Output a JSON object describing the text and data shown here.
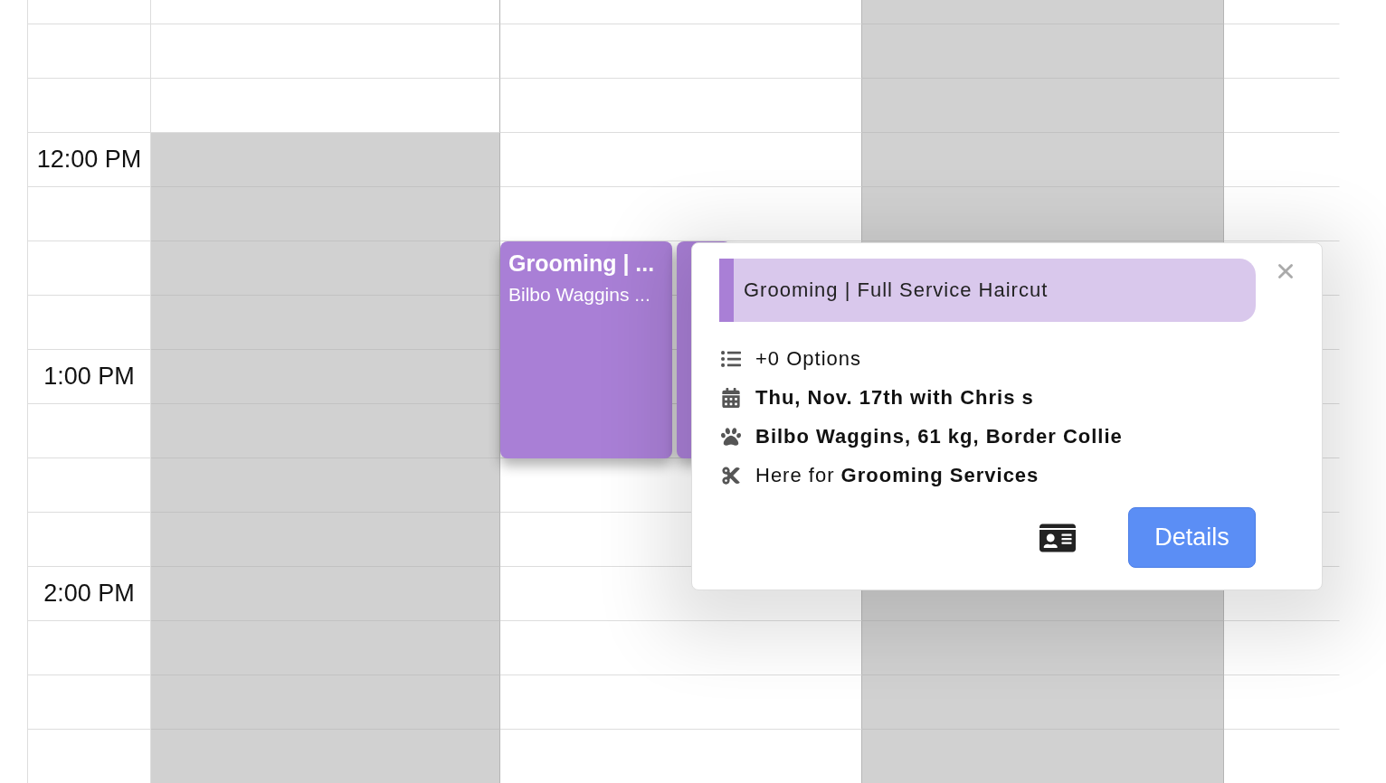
{
  "calendar": {
    "rows": [
      {
        "column_1": {
          "blocked": false
        },
        "column_2": {
          "blocked": false
        },
        "column_3": {
          "blocked": true
        },
        "column_4": {
          "blocked": false
        }
      },
      {
        "column_1": {
          "blocked": false
        },
        "column_2": {
          "blocked": false
        },
        "column_3": {
          "blocked": true
        },
        "column_4": {
          "blocked": false
        }
      },
      {
        "column_1": {
          "blocked": false
        },
        "column_2": {
          "blocked": false
        },
        "column_3": {
          "blocked": true
        },
        "column_4": {
          "blocked": false
        }
      },
      {
        "time": "12:00 PM",
        "column_1": {
          "blocked": true
        },
        "column_2": {
          "blocked": false
        },
        "column_3": {
          "blocked": true
        },
        "column_4": {
          "blocked": false
        }
      },
      {
        "column_1": {
          "blocked": true
        },
        "column_2": {
          "blocked": false
        },
        "column_3": {
          "blocked": true
        },
        "column_4": {
          "blocked": false
        }
      },
      {
        "column_1": {
          "blocked": true
        },
        "column_2": {
          "blocked": false
        },
        "column_3": {
          "blocked": true
        },
        "column_4": {
          "blocked": false
        }
      },
      {
        "column_1": {
          "blocked": true
        },
        "column_2": {
          "blocked": false
        },
        "column_4": {
          "blocked": false
        }
      },
      {
        "time": "1:00 PM",
        "column_1": {
          "blocked": true
        },
        "column_2": {
          "blocked": false
        },
        "column_4": {
          "blocked": false
        }
      },
      {
        "column_1": {
          "blocked": true
        },
        "column_2": {
          "blocked": false
        },
        "column_4": {
          "blocked": false
        }
      },
      {
        "column_1": {
          "blocked": true
        },
        "column_2": {
          "blocked": false
        },
        "column_4": {
          "blocked": false
        }
      },
      {
        "column_1": {
          "blocked": true
        },
        "column_2": {
          "blocked": false
        },
        "column_4": {
          "blocked": false
        }
      },
      {
        "time": "2:00 PM",
        "column_1": {
          "blocked": true
        },
        "column_2": {
          "blocked": false
        },
        "column_3": {
          "blocked": true
        },
        "column_4": {
          "blocked": false
        }
      },
      {
        "column_1": {
          "blocked": true
        },
        "column_2": {
          "blocked": false
        },
        "column_3": {
          "blocked": true
        },
        "column_4": {
          "blocked": false
        }
      },
      {
        "column_1": {
          "blocked": true
        },
        "column_2": {
          "blocked": false
        },
        "column_3": {
          "blocked": true
        },
        "column_4": {
          "blocked": false
        }
      },
      {
        "column_1": {
          "blocked": true
        },
        "column_2": {
          "blocked": false
        },
        "column_3": {
          "blocked": true
        },
        "column_4": {
          "blocked": false
        }
      }
    ],
    "events": [
      {
        "title": "Grooming | ...",
        "client": "Bilbo Waggins ...",
        "color": "#a97fd6"
      },
      {
        "color": "#a97fd6"
      }
    ]
  },
  "popover": {
    "title": "Grooming | Full Service Haircut",
    "color": "#a97fd6",
    "lines": [
      {
        "kind": "options",
        "text": "+0 Options"
      },
      {
        "kind": "date",
        "text": "**Thu, Nov. 17th with Chris s**"
      },
      {
        "kind": "pet",
        "text": "**Bilbo Waggins, 61 kg, Border Collie**"
      },
      {
        "kind": "service",
        "text": "Here for **Grooming Services**"
      }
    ],
    "button": "Details"
  }
}
